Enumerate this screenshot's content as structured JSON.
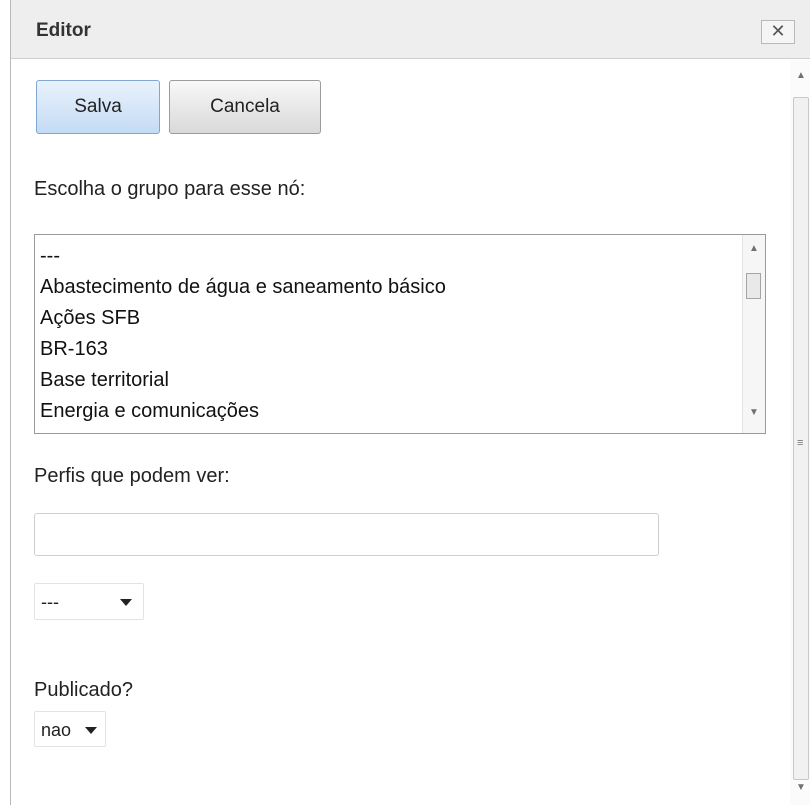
{
  "window": {
    "title": "Editor",
    "close_glyph": "✕"
  },
  "toolbar": {
    "save_label": "Salva",
    "cancel_label": "Cancela"
  },
  "group_field": {
    "label": "Escolha o grupo para esse nó:",
    "options": [
      "---",
      "Abastecimento de água e saneamento básico",
      "Ações SFB",
      "BR-163",
      "Base territorial",
      "Energia e comunicações"
    ]
  },
  "profiles_field": {
    "label": "Perfis que podem ver:",
    "value": "",
    "select_value": "---"
  },
  "published_field": {
    "label": "Publicado?",
    "select_value": "nao"
  },
  "icons": {
    "close": "close-icon",
    "scroll_up": "arrow-up-icon",
    "scroll_down": "arrow-down-icon",
    "dropdown": "chevron-down-icon"
  },
  "colors": {
    "save_button_top": "#e9f2fc",
    "save_button_bottom": "#c4dbf5",
    "titlebar": "#eeeeee"
  }
}
